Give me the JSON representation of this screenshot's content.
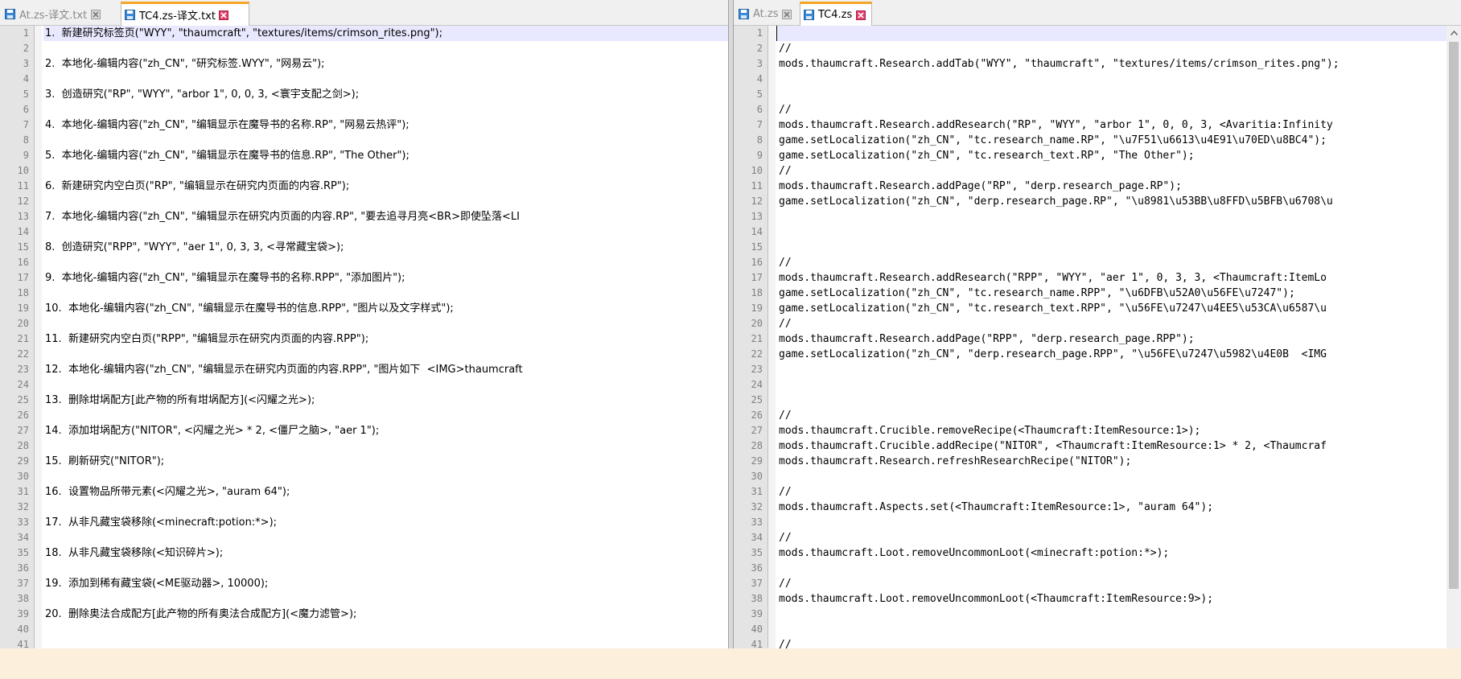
{
  "left_pane": {
    "tabs": [
      {
        "label": "At.zs-译文.txt",
        "active": false
      },
      {
        "label": "TC4.zs-译文.txt",
        "active": true
      }
    ],
    "line_numbers": [
      "1",
      "2",
      "3",
      "4",
      "5",
      "6",
      "7",
      "8",
      "9",
      "10",
      "11",
      "12",
      "13",
      "14",
      "15",
      "16",
      "17",
      "18",
      "19",
      "20",
      "21",
      "22",
      "23",
      "24",
      "25",
      "26",
      "27",
      "28",
      "29",
      "30",
      "31",
      "32",
      "33",
      "34",
      "35",
      "36",
      "37",
      "38",
      "39",
      "40",
      "41"
    ],
    "lines": [
      "1.  新建研究标签页(\"WYY\", \"thaumcraft\", \"textures/items/crimson_rites.png\");",
      "",
      "2.  本地化-编辑内容(\"zh_CN\", \"研究标签.WYY\", \"网易云\");",
      "",
      "3.  创造研究(\"RP\", \"WYY\", \"arbor 1\", 0, 0, 3, <寰宇支配之剑>);",
      "",
      "4.  本地化-编辑内容(\"zh_CN\", \"编辑显示在魔导书的名称.RP\", \"网易云热评\");",
      "",
      "5.  本地化-编辑内容(\"zh_CN\", \"编辑显示在魔导书的信息.RP\", \"The Other\");",
      "",
      "6.  新建研究内空白页(\"RP\", \"编辑显示在研究内页面的内容.RP\");",
      "",
      "7.  本地化-编辑内容(\"zh_CN\", \"编辑显示在研究内页面的内容.RP\", \"要去追寻月亮<BR>即使坠落<LI",
      "",
      "8.  创造研究(\"RPP\", \"WYY\", \"aer 1\", 0, 3, 3, <寻常藏宝袋>);",
      "",
      "9.  本地化-编辑内容(\"zh_CN\", \"编辑显示在魔导书的名称.RPP\", \"添加图片\");",
      "",
      "10.  本地化-编辑内容(\"zh_CN\", \"编辑显示在魔导书的信息.RPP\", \"图片以及文字样式\");",
      "",
      "11.  新建研究内空白页(\"RPP\", \"编辑显示在研究内页面的内容.RPP\");",
      "",
      "12.  本地化-编辑内容(\"zh_CN\", \"编辑显示在研究内页面的内容.RPP\", \"图片如下  <IMG>thaumcraft",
      "",
      "13.  删除坩埚配方[此产物的所有坩埚配方](<闪耀之光>);",
      "",
      "14.  添加坩埚配方(\"NITOR\", <闪耀之光> * 2, <僵尸之脑>, \"aer 1\");",
      "",
      "15.  刷新研究(\"NITOR\");",
      "",
      "16.  设置物品所带元素(<闪耀之光>, \"auram 64\");",
      "",
      "17.  从非凡藏宝袋移除(<minecraft:potion:*>);",
      "",
      "18.  从非凡藏宝袋移除(<知识碎片>);",
      "",
      "19.  添加到稀有藏宝袋(<ME驱动器>, 10000);",
      "",
      "20.  删除奥法合成配方[此产物的所有奥法合成配方](<魔力滤管>);",
      "",
      ""
    ]
  },
  "right_pane": {
    "tabs": [
      {
        "label": "At.zs",
        "active": false
      },
      {
        "label": "TC4.zs",
        "active": true
      }
    ],
    "line_numbers": [
      "1",
      "2",
      "3",
      "4",
      "5",
      "6",
      "7",
      "8",
      "9",
      "10",
      "11",
      "12",
      "13",
      "14",
      "15",
      "16",
      "17",
      "18",
      "19",
      "20",
      "21",
      "22",
      "23",
      "24",
      "25",
      "26",
      "27",
      "28",
      "29",
      "30",
      "31",
      "32",
      "33",
      "34",
      "35",
      "36",
      "37",
      "38",
      "39",
      "40",
      "41"
    ],
    "lines": [
      "",
      "//",
      "mods.thaumcraft.Research.addTab(\"WYY\", \"thaumcraft\", \"textures/items/crimson_rites.png\");",
      "",
      "",
      "//",
      "mods.thaumcraft.Research.addResearch(\"RP\", \"WYY\", \"arbor 1\", 0, 0, 3, <Avaritia:Infinity",
      "game.setLocalization(\"zh_CN\", \"tc.research_name.RP\", \"\\u7F51\\u6613\\u4E91\\u70ED\\u8BC4\");",
      "game.setLocalization(\"zh_CN\", \"tc.research_text.RP\", \"The Other\");",
      "//",
      "mods.thaumcraft.Research.addPage(\"RP\", \"derp.research_page.RP\");",
      "game.setLocalization(\"zh_CN\", \"derp.research_page.RP\", \"\\u8981\\u53BB\\u8FFD\\u5BFB\\u6708\\u",
      "",
      "",
      "",
      "//",
      "mods.thaumcraft.Research.addResearch(\"RPP\", \"WYY\", \"aer 1\", 0, 3, 3, <Thaumcraft:ItemLo",
      "game.setLocalization(\"zh_CN\", \"tc.research_name.RPP\", \"\\u6DFB\\u52A0\\u56FE\\u7247\");",
      "game.setLocalization(\"zh_CN\", \"tc.research_text.RPP\", \"\\u56FE\\u7247\\u4EE5\\u53CA\\u6587\\u",
      "//",
      "mods.thaumcraft.Research.addPage(\"RPP\", \"derp.research_page.RPP\");",
      "game.setLocalization(\"zh_CN\", \"derp.research_page.RPP\", \"\\u56FE\\u7247\\u5982\\u4E0B  <IMG",
      "",
      "",
      "",
      "//",
      "mods.thaumcraft.Crucible.removeRecipe(<Thaumcraft:ItemResource:1>);",
      "mods.thaumcraft.Crucible.addRecipe(\"NITOR\", <Thaumcraft:ItemResource:1> * 2, <Thaumcraf",
      "mods.thaumcraft.Research.refreshResearchRecipe(\"NITOR\");",
      "",
      "//",
      "mods.thaumcraft.Aspects.set(<Thaumcraft:ItemResource:1>, \"auram 64\");",
      "",
      "//",
      "mods.thaumcraft.Loot.removeUncommonLoot(<minecraft:potion:*>);",
      "",
      "//",
      "mods.thaumcraft.Loot.removeUncommonLoot(<Thaumcraft:ItemResource:9>);",
      "",
      "",
      "//"
    ]
  },
  "icons": {
    "save": "save-icon",
    "close": "close-icon",
    "scroll_up": "scroll-up-arrow-icon"
  },
  "colors": {
    "active_tab_accent": "#f5a623",
    "close_icon": "#e0406a",
    "save_icon": "#3b8ad8",
    "current_line": "#e8e8ff",
    "background": "#fcf0dc"
  }
}
